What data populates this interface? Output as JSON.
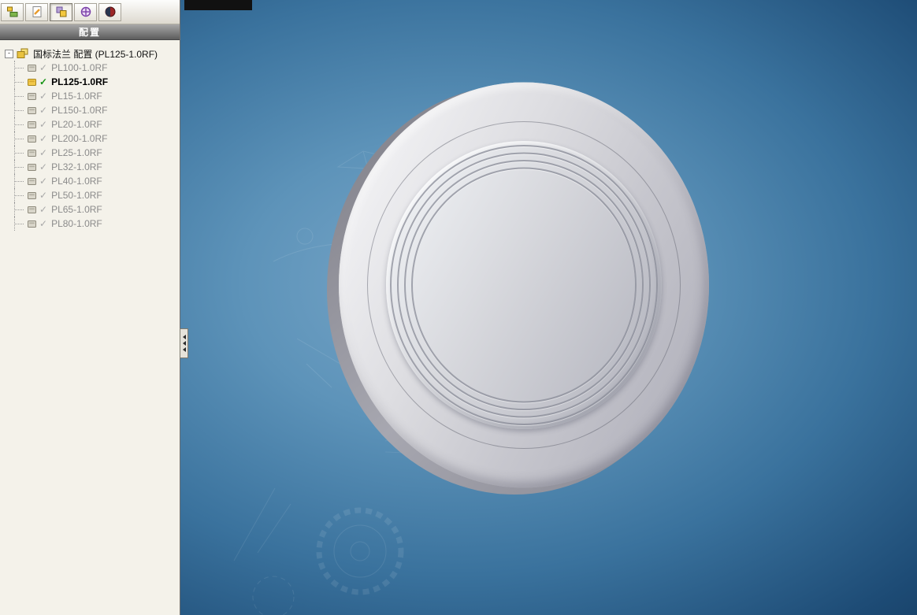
{
  "panel": {
    "header_label": "配置",
    "tabs": [
      {
        "name": "featuremanager-tab"
      },
      {
        "name": "propertymanager-tab"
      },
      {
        "name": "configurationmanager-tab"
      },
      {
        "name": "dimxpertmanager-tab"
      },
      {
        "name": "displaymanager-tab"
      }
    ]
  },
  "tree": {
    "expander_glyph": "-",
    "check_glyph": "✓",
    "root_label": "国标法兰 配置  (PL125-1.0RF)",
    "items": [
      {
        "label": "PL100-1.0RF",
        "active": false
      },
      {
        "label": "PL125-1.0RF",
        "active": true
      },
      {
        "label": "PL15-1.0RF",
        "active": false
      },
      {
        "label": "PL150-1.0RF",
        "active": false
      },
      {
        "label": "PL20-1.0RF",
        "active": false
      },
      {
        "label": "PL200-1.0RF",
        "active": false
      },
      {
        "label": "PL25-1.0RF",
        "active": false
      },
      {
        "label": "PL32-1.0RF",
        "active": false
      },
      {
        "label": "PL40-1.0RF",
        "active": false
      },
      {
        "label": "PL50-1.0RF",
        "active": false
      },
      {
        "label": "PL65-1.0RF",
        "active": false
      },
      {
        "label": "PL80-1.0RF",
        "active": false
      }
    ]
  },
  "colors": {
    "active_check": "#149414",
    "inactive_text": "#8b8b8b",
    "active_text": "#000000",
    "header_bg_top": "#a8a8a8",
    "header_bg_bottom": "#5c5c5c",
    "viewport_center": "#79a7c9",
    "viewport_edge": "#0c2a48"
  }
}
